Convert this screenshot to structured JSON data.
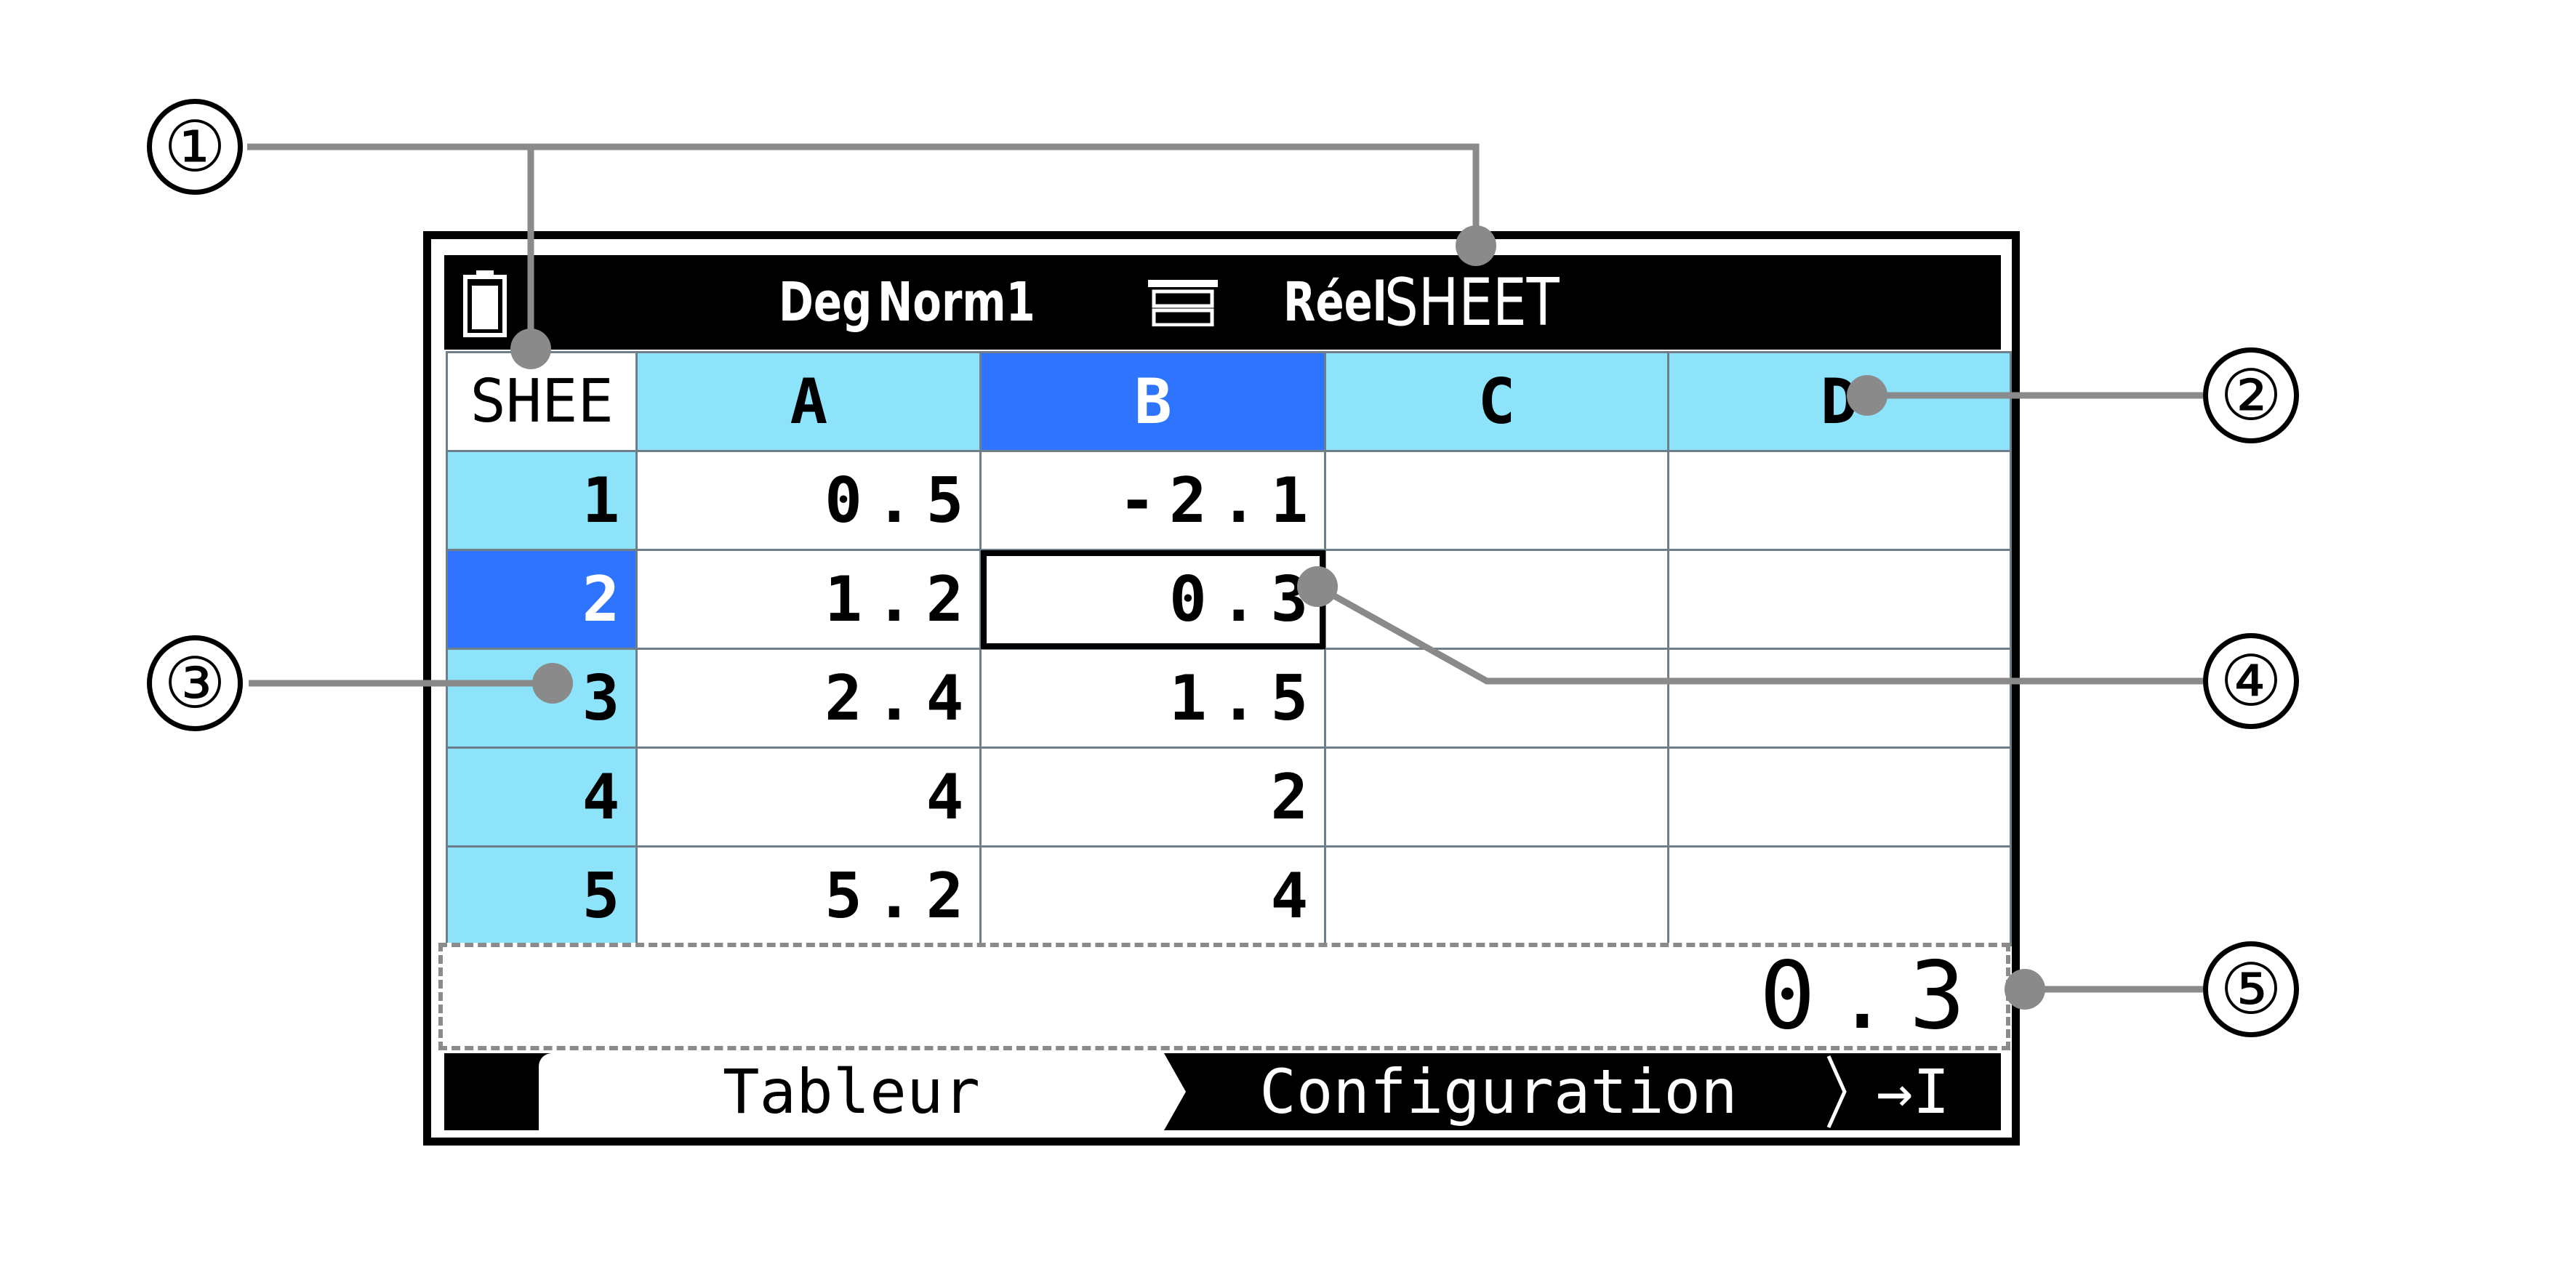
{
  "status_bar": {
    "angle_unit": "Deg",
    "display_format": "Norm1",
    "complex_mode": "Réel",
    "mode_name": "SHEET",
    "battery_icon": "battery-icon",
    "display_icon": "screen-split-icon"
  },
  "sheet": {
    "corner_label": "SHEE",
    "columns": [
      "A",
      "B",
      "C",
      "D"
    ],
    "rows": [
      {
        "label": "1",
        "cells": [
          "0.5",
          "-2.1",
          "",
          ""
        ]
      },
      {
        "label": "2",
        "cells": [
          "1.2",
          "0.3",
          "",
          ""
        ]
      },
      {
        "label": "3",
        "cells": [
          "2.4",
          "1.5",
          "",
          ""
        ]
      },
      {
        "label": "4",
        "cells": [
          "4",
          "2",
          "",
          ""
        ]
      },
      {
        "label": "5",
        "cells": [
          "5.2",
          "4",
          "",
          ""
        ]
      }
    ],
    "selected_column": "B",
    "selected_row": "2",
    "active_cell": "B2"
  },
  "edit_line": {
    "value": "0.3"
  },
  "function_keys": {
    "f1": "Tableur",
    "f2": "Configuration",
    "f3_icon": "next-page-icon",
    "f3": "→I"
  },
  "callouts": [
    "①",
    "②",
    "③",
    "④",
    "⑤"
  ],
  "colors": {
    "header_cyan": "#8de3fa",
    "selected_blue": "#2e74ff",
    "grid_line": "#6f7f89",
    "callout_gray": "#8a8a8a"
  }
}
